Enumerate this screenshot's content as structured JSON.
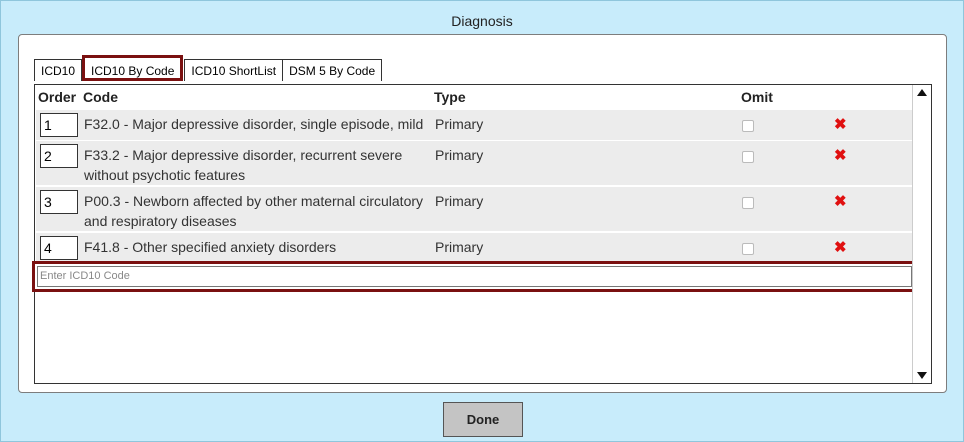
{
  "dialog": {
    "title": "Diagnosis"
  },
  "tabs": [
    {
      "label": "ICD10"
    },
    {
      "label": "ICD10 By Code",
      "active": true
    },
    {
      "label": "ICD10 ShortList"
    },
    {
      "label": "DSM 5 By Code"
    }
  ],
  "columns": {
    "order": "Order",
    "code": "Code",
    "type": "Type",
    "omit": "Omit"
  },
  "rows": [
    {
      "order": "1",
      "code": "F32.0 - Major depressive disorder, single episode, mild",
      "type": "Primary",
      "omit": false
    },
    {
      "order": "2",
      "code": "F33.2 - Major depressive disorder, recurrent severe without psychotic features",
      "type": "Primary",
      "omit": false
    },
    {
      "order": "3",
      "code": "P00.3 - Newborn affected by other maternal circulatory and respiratory diseases",
      "type": "Primary",
      "omit": false
    },
    {
      "order": "4",
      "code": "F41.8 - Other specified anxiety disorders",
      "type": "Primary",
      "omit": false
    }
  ],
  "entry": {
    "placeholder": "Enter ICD10 Code",
    "value": ""
  },
  "delete_icon": {
    "glyph": "✖",
    "color": "#e01010"
  },
  "footer": {
    "done_label": "Done"
  },
  "colors": {
    "background": "#c8ecfb",
    "highlight_border": "#7a1010"
  }
}
